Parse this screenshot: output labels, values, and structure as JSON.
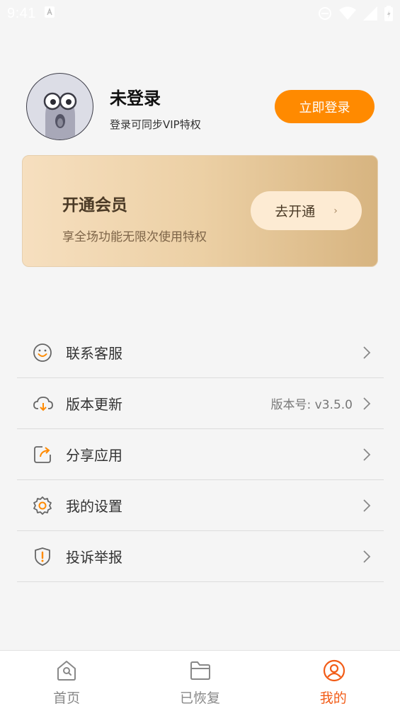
{
  "status_bar": {
    "time": "9:41",
    "icons": [
      "notification-a-icon",
      "do-not-disturb-icon",
      "wifi-icon",
      "signal-icon",
      "battery-icon"
    ]
  },
  "profile": {
    "name": "未登录",
    "subtitle": "登录可同步VIP特权",
    "login_button": "立即登录"
  },
  "vip": {
    "title": "开通会员",
    "subtitle": "享全场功能无限次使用特权",
    "button": "去开通",
    "chevron": "›"
  },
  "menu": {
    "items": [
      {
        "label": "联系客服",
        "value": "",
        "icon": "smile-face-icon"
      },
      {
        "label": "版本更新",
        "value": "版本号: v3.5.0",
        "icon": "cloud-download-icon"
      },
      {
        "label": "分享应用",
        "value": "",
        "icon": "share-arrow-icon"
      },
      {
        "label": "我的设置",
        "value": "",
        "icon": "gear-icon"
      },
      {
        "label": "投诉举报",
        "value": "",
        "icon": "warning-shield-icon"
      }
    ]
  },
  "bottom_nav": {
    "items": [
      {
        "label": "首页",
        "icon": "home-icon",
        "active": false
      },
      {
        "label": "已恢复",
        "icon": "folder-icon",
        "active": false
      },
      {
        "label": "我的",
        "icon": "user-icon",
        "active": true
      }
    ]
  },
  "colors": {
    "accent": "#ff8a00",
    "nav_active": "#f25c17",
    "vip_gradient_start": "#f6dfbf",
    "vip_gradient_end": "#d7b480",
    "background": "#f5f5f5"
  }
}
